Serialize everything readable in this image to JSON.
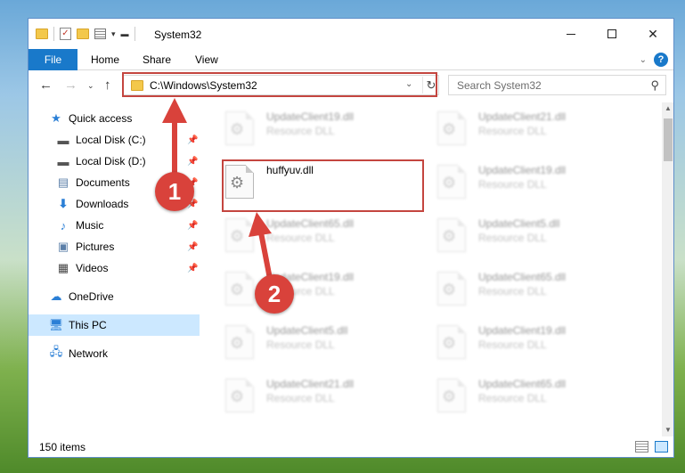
{
  "window": {
    "title": "System32"
  },
  "ribbon": {
    "file_tab": "File",
    "tabs": [
      "Home",
      "Share",
      "View"
    ]
  },
  "address": {
    "path": "C:\\Windows\\System32"
  },
  "search": {
    "placeholder": "Search System32"
  },
  "sidebar": {
    "items": [
      {
        "label": "Quick access",
        "icon": "star-icon",
        "pinned": false
      },
      {
        "label": "Local Disk (C:)",
        "icon": "drive-icon",
        "pinned": true
      },
      {
        "label": "Local Disk (D:)",
        "icon": "drive-icon",
        "pinned": true
      },
      {
        "label": "Documents",
        "icon": "document-icon",
        "pinned": true
      },
      {
        "label": "Downloads",
        "icon": "download-icon",
        "pinned": true
      },
      {
        "label": "Music",
        "icon": "music-icon",
        "pinned": true
      },
      {
        "label": "Pictures",
        "icon": "picture-icon",
        "pinned": true
      },
      {
        "label": "Videos",
        "icon": "video-icon",
        "pinned": true
      },
      {
        "label": "OneDrive",
        "icon": "cloud-icon",
        "pinned": false
      },
      {
        "label": "This PC",
        "icon": "computer-icon",
        "pinned": false,
        "selected": true
      },
      {
        "label": "Network",
        "icon": "network-icon",
        "pinned": false
      }
    ]
  },
  "files": {
    "left": [
      {
        "name": "UpdateClient19.dll",
        "type": "Resource DLL"
      },
      {
        "name": "huffyuv.dll",
        "type": ""
      },
      {
        "name": "UpdateClient65.dll",
        "type": "Resource DLL"
      },
      {
        "name": "UpdateClient19.dll",
        "type": "Resource DLL"
      },
      {
        "name": "UpdateClient5.dll",
        "type": "Resource DLL"
      },
      {
        "name": "UpdateClient21.dll",
        "type": "Resource DLL"
      }
    ],
    "right": [
      {
        "name": "UpdateClient21.dll",
        "type": "Resource DLL"
      },
      {
        "name": "UpdateClient19.dll",
        "type": "Resource DLL"
      },
      {
        "name": "UpdateClient5.dll",
        "type": "Resource DLL"
      },
      {
        "name": "UpdateClient65.dll",
        "type": "Resource DLL"
      },
      {
        "name": "UpdateClient19.dll",
        "type": "Resource DLL"
      },
      {
        "name": "UpdateClient65.dll",
        "type": "Resource DLL"
      }
    ]
  },
  "status": {
    "item_count": "150 items"
  },
  "annotations": {
    "step1": "1",
    "step2": "2"
  },
  "colors": {
    "accent": "#1979ca",
    "annotation": "#d9423b",
    "selected": "#cce8ff"
  }
}
